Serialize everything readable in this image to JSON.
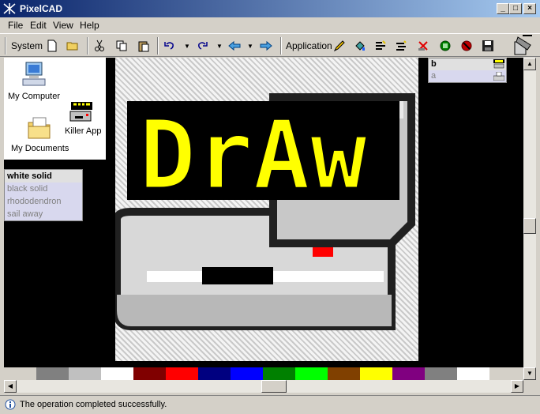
{
  "window": {
    "title": "PixelCAD"
  },
  "menu": [
    "File",
    "Edit",
    "View",
    "Help"
  ],
  "toolbar": {
    "system_label": "System",
    "application_label": "Application"
  },
  "desktop": {
    "icons": [
      {
        "label": "My Computer",
        "icon": "computer-icon"
      },
      {
        "label": "Killer App",
        "icon": "draw-app-icon"
      },
      {
        "label": "My Documents",
        "icon": "folder-icon"
      }
    ]
  },
  "brush_list": {
    "items": [
      "white solid",
      "black solid",
      "rhododendron",
      "sail away"
    ],
    "selected": "white solid"
  },
  "right_panel": {
    "header": "b",
    "item": "a"
  },
  "canvas": {
    "title_text": "DrAw"
  },
  "palette": [
    "#808080",
    "#c0c0c0",
    "#ffffff",
    "#800000",
    "#ff0000",
    "#000080",
    "#0000ff",
    "#008000",
    "#00ff00",
    "#804000",
    "#ffff00",
    "#800080",
    "#808080",
    "#ffffff"
  ],
  "status": {
    "message": "The operation completed successfully."
  }
}
